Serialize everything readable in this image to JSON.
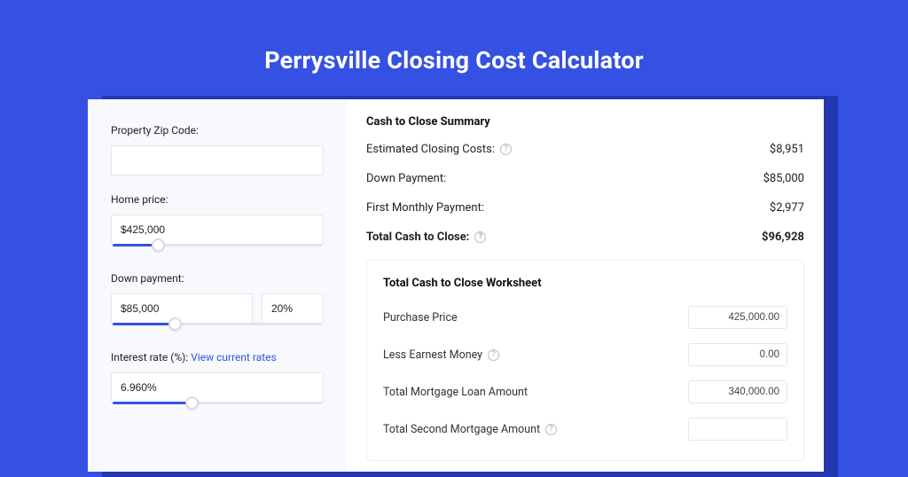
{
  "title": "Perrysville Closing Cost Calculator",
  "left": {
    "zip_label": "Property Zip Code:",
    "zip_value": "",
    "home_price_label": "Home price:",
    "home_price_value": "$425,000",
    "home_price_slider_pct": 22,
    "down_payment_label": "Down payment:",
    "down_payment_value": "$85,000",
    "down_payment_pct": "20%",
    "down_payment_slider_pct": 30,
    "interest_label": "Interest rate (%):",
    "interest_link": "View current rates",
    "interest_value": "6.960%",
    "interest_slider_pct": 38
  },
  "summary": {
    "heading": "Cash to Close Summary",
    "rows": [
      {
        "label": "Estimated Closing Costs:",
        "help": true,
        "value": "$8,951",
        "bold": false
      },
      {
        "label": "Down Payment:",
        "help": false,
        "value": "$85,000",
        "bold": false
      },
      {
        "label": "First Monthly Payment:",
        "help": false,
        "value": "$2,977",
        "bold": false
      },
      {
        "label": "Total Cash to Close:",
        "help": true,
        "value": "$96,928",
        "bold": true
      }
    ]
  },
  "worksheet": {
    "heading": "Total Cash to Close Worksheet",
    "rows": [
      {
        "label": "Purchase Price",
        "help": false,
        "value": "425,000.00"
      },
      {
        "label": "Less Earnest Money",
        "help": true,
        "value": "0.00"
      },
      {
        "label": "Total Mortgage Loan Amount",
        "help": false,
        "value": "340,000.00"
      },
      {
        "label": "Total Second Mortgage Amount",
        "help": true,
        "value": ""
      }
    ]
  }
}
